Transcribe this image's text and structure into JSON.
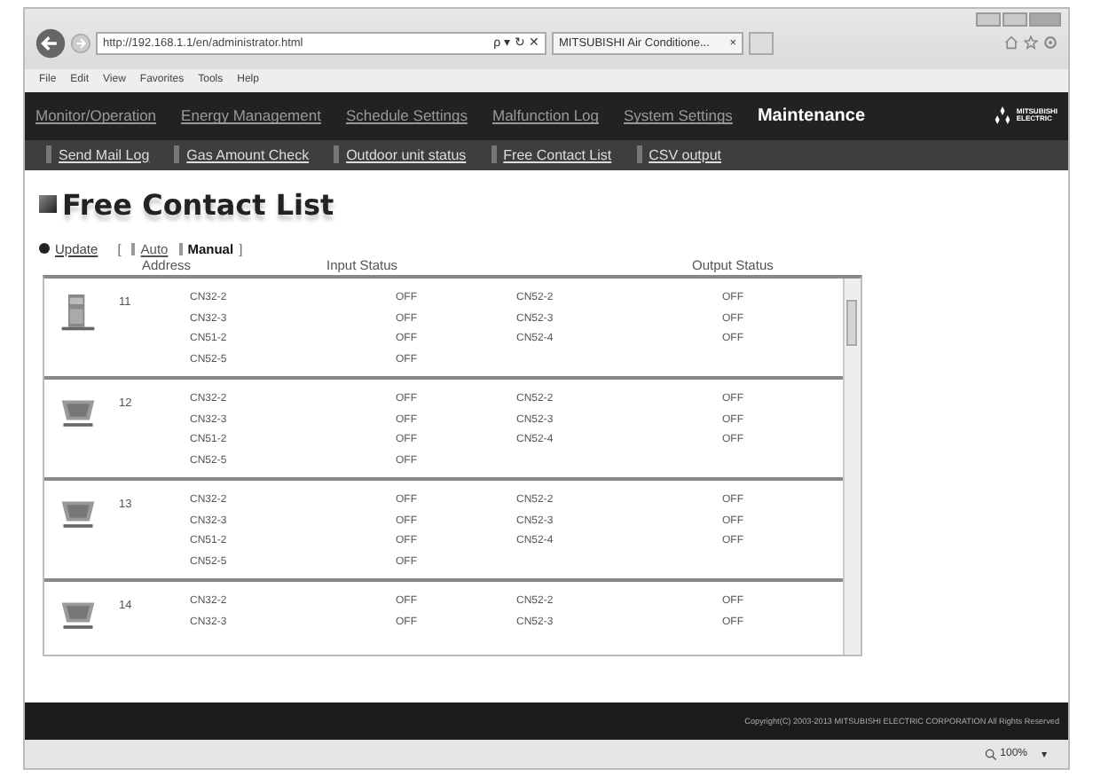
{
  "browser": {
    "address": "http://192.168.1.1/en/administrator.html",
    "address_controls": "ρ ▾ ↻ ✕",
    "tab": "MITSUBISHI Air Conditione...",
    "tab_close": "×",
    "menu": [
      "File",
      "Edit",
      "View",
      "Favorites",
      "Tools",
      "Help"
    ]
  },
  "main_nav": [
    {
      "label": "Monitor/Operation",
      "selected": false
    },
    {
      "label": "Energy Management",
      "selected": false
    },
    {
      "label": "Schedule Settings",
      "selected": false
    },
    {
      "label": "Malfunction Log",
      "selected": false
    },
    {
      "label": "System Settings",
      "selected": false
    },
    {
      "label": "Maintenance",
      "selected": true
    }
  ],
  "logo": {
    "line1": "MITSUBISHI",
    "line2": "ELECTRIC"
  },
  "sub_nav": [
    {
      "label": "Send Mail Log"
    },
    {
      "label": "Gas Amount Check"
    },
    {
      "label": "Outdoor unit status"
    },
    {
      "label": "Free Contact List"
    },
    {
      "label": "CSV output"
    }
  ],
  "page_title": "Free Contact List",
  "update": {
    "link": "Update",
    "open_bracket": "[",
    "modes": [
      {
        "label": "Auto",
        "selected": false
      },
      {
        "label": "Manual",
        "selected": true
      }
    ],
    "close_bracket": "]"
  },
  "table": {
    "columns": [
      "Address",
      "Input Status",
      "Output Status"
    ],
    "rows": [
      {
        "kind": "floor",
        "address": "11",
        "inputs": [
          [
            "CN32-2",
            "OFF"
          ],
          [
            "CN32-3",
            "OFF"
          ],
          [
            "CN51-2",
            "OFF"
          ],
          [
            "CN52-5",
            "OFF"
          ]
        ],
        "outputs": [
          [
            "CN52-2",
            "OFF"
          ],
          [
            "CN52-3",
            "OFF"
          ],
          [
            "CN52-4",
            "OFF"
          ]
        ]
      },
      {
        "kind": "cassette",
        "address": "12",
        "inputs": [
          [
            "CN32-2",
            "OFF"
          ],
          [
            "CN32-3",
            "OFF"
          ],
          [
            "CN51-2",
            "OFF"
          ],
          [
            "CN52-5",
            "OFF"
          ]
        ],
        "outputs": [
          [
            "CN52-2",
            "OFF"
          ],
          [
            "CN52-3",
            "OFF"
          ],
          [
            "CN52-4",
            "OFF"
          ]
        ]
      },
      {
        "kind": "cassette",
        "address": "13",
        "inputs": [
          [
            "CN32-2",
            "OFF"
          ],
          [
            "CN32-3",
            "OFF"
          ],
          [
            "CN51-2",
            "OFF"
          ],
          [
            "CN52-5",
            "OFF"
          ]
        ],
        "outputs": [
          [
            "CN52-2",
            "OFF"
          ],
          [
            "CN52-3",
            "OFF"
          ],
          [
            "CN52-4",
            "OFF"
          ]
        ]
      },
      {
        "kind": "cassette",
        "address": "14",
        "inputs": [
          [
            "CN32-2",
            "OFF"
          ],
          [
            "CN32-3",
            "OFF"
          ]
        ],
        "outputs": [
          [
            "CN52-2",
            "OFF"
          ],
          [
            "CN52-3",
            "OFF"
          ]
        ]
      }
    ]
  },
  "footer": "Copyright(C) 2003-2013 MITSUBISHI ELECTRIC CORPORATION All Rights Reserved",
  "status_bar": {
    "zoom": "100%",
    "zoom_caret": "▾"
  }
}
